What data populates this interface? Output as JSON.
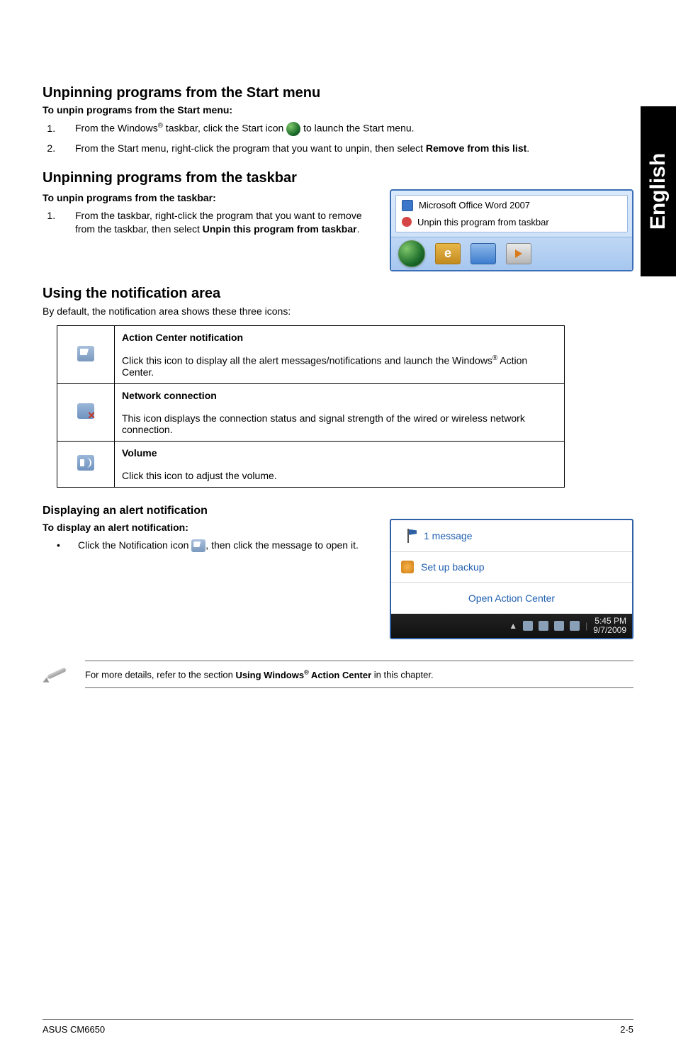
{
  "sideTab": "English",
  "sec1": {
    "heading": "Unpinning programs from the Start menu",
    "sub": "To unpin programs from the Start menu:",
    "steps": [
      {
        "pre": "From the Windows",
        "sup": "®",
        "mid": " taskbar, click the Start icon ",
        "post": " to launch the Start menu."
      },
      {
        "pre": "From the Start menu, right-click the program that you want to unpin, then select ",
        "bold": "Remove from this list",
        "post": "."
      }
    ]
  },
  "sec2": {
    "heading": "Unpinning programs from the taskbar",
    "sub": "To unpin programs from the taskbar:",
    "step_pre": "From the taskbar, right-click the program that you want to remove from the taskbar, then select ",
    "step_bold": "Unpin this program from taskbar",
    "step_post": ".",
    "context_row1": "Microsoft Office Word 2007",
    "context_row2": "Unpin this program from taskbar"
  },
  "sec3": {
    "heading": "Using the notification area",
    "intro": "By default, the notification area shows these three icons:",
    "rows": [
      {
        "title": "Action Center notification",
        "body_pre": "Click this icon to display all the alert messages/notifications and launch the Windows",
        "sup": "®",
        "body_post": " Action Center."
      },
      {
        "title": "Network connection",
        "body": "This icon displays the connection status and signal strength of the wired or wireless network connection."
      },
      {
        "title": "Volume",
        "body": "Click this icon to adjust the volume."
      }
    ]
  },
  "sec4": {
    "heading": "Displaying an alert notification",
    "sub": "To display an alert notification:",
    "bullet_pre": "Click the Notification icon ",
    "bullet_post": ", then click the message to open it.",
    "ac_msg": "1 message",
    "ac_backup": "Set up backup",
    "ac_open": "Open Action Center",
    "ac_time": "5:45 PM",
    "ac_date": "9/7/2009"
  },
  "note": {
    "pre": "For more details, refer to the section ",
    "bold_a": "Using Windows",
    "sup": "®",
    "bold_b": " Action Center",
    "post": " in this chapter."
  },
  "footer": {
    "left": "ASUS CM6650",
    "right": "2-5"
  }
}
